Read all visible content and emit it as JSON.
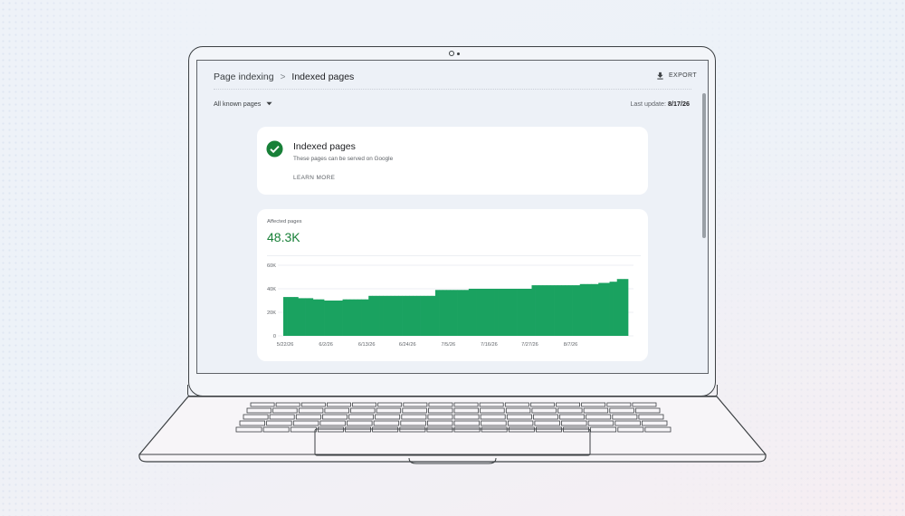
{
  "header": {
    "breadcrumb_parent": "Page indexing",
    "breadcrumb_separator": ">",
    "breadcrumb_current": "Indexed pages",
    "export_label": "EXPORT",
    "export_icon": "download-icon"
  },
  "filter": {
    "selected": "All known pages",
    "icon": "caret-down-icon"
  },
  "last_update": {
    "label": "Last update:",
    "value": "8/17/26"
  },
  "status_card": {
    "icon": "check-circle-icon",
    "icon_color": "#188038",
    "title": "Indexed pages",
    "subtitle": "These pages can be served on Google",
    "learn_more": "LEARN MORE"
  },
  "affected_card": {
    "label": "Affected pages",
    "value": "48.3K",
    "value_color": "#188038"
  },
  "chart_data": {
    "type": "area",
    "bar_color": "#1aa260",
    "ylim": [
      0,
      60000
    ],
    "y_ticks": [
      0,
      20000,
      40000,
      60000
    ],
    "y_tick_labels": [
      "0",
      "20K",
      "40K",
      "60K"
    ],
    "x_tick_labels": [
      "5/22/26",
      "6/2/26",
      "6/13/26",
      "6/24/26",
      "7/5/26",
      "7/16/26",
      "7/27/26",
      "8/7/26"
    ],
    "x_tick_indices": [
      0,
      11,
      22,
      33,
      44,
      55,
      66,
      77
    ],
    "grid": true,
    "values": [
      33000,
      33000,
      33000,
      33000,
      32000,
      32000,
      32000,
      32000,
      31000,
      31000,
      31000,
      30000,
      30000,
      30000,
      30000,
      30000,
      31000,
      31000,
      31000,
      31000,
      31000,
      31000,
      31000,
      34000,
      34000,
      34000,
      34000,
      34000,
      34000,
      34000,
      34000,
      34000,
      34000,
      34000,
      34000,
      34000,
      34000,
      34000,
      34000,
      34000,
      34000,
      39000,
      39000,
      39000,
      39000,
      39000,
      39000,
      39000,
      39000,
      39000,
      40000,
      40000,
      40000,
      40000,
      40000,
      40000,
      40000,
      40000,
      40000,
      40000,
      40000,
      40000,
      40000,
      40000,
      40000,
      40000,
      40000,
      43000,
      43000,
      43000,
      43000,
      43000,
      43000,
      43000,
      43000,
      43000,
      43000,
      43000,
      43000,
      43000,
      44000,
      44000,
      44000,
      44000,
      44000,
      45000,
      45000,
      45000,
      46000,
      46000,
      48300,
      48300,
      48300
    ]
  }
}
